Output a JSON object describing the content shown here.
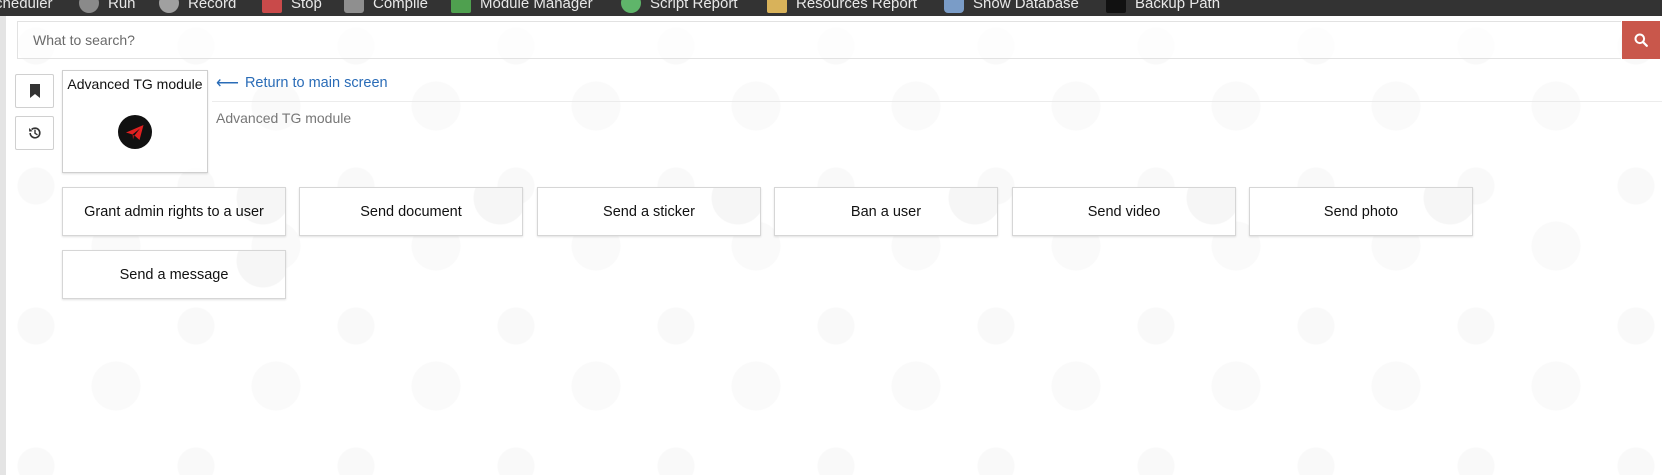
{
  "toolbar": {
    "items": [
      {
        "label": "Scheduler",
        "icon": "calendar-icon"
      },
      {
        "label": "Run",
        "icon": "play-icon"
      },
      {
        "label": "Record",
        "icon": "record-icon"
      },
      {
        "label": "Stop",
        "icon": "stop-icon"
      },
      {
        "label": "Compile",
        "icon": "compile-icon"
      },
      {
        "label": "Module Manager",
        "icon": "home-icon"
      },
      {
        "label": "Script Report",
        "icon": "leaf-icon"
      },
      {
        "label": "Resources Report",
        "icon": "folder-icon"
      },
      {
        "label": "Show Database",
        "icon": "database-icon"
      },
      {
        "label": "Backup Path",
        "icon": "drive-icon"
      }
    ]
  },
  "search": {
    "placeholder": "What to search?",
    "button_icon": "search-icon",
    "button_color": "#c9574b"
  },
  "side_buttons": [
    {
      "icon": "bookmark-icon"
    },
    {
      "icon": "history-icon"
    }
  ],
  "module": {
    "title": "Advanced TG module",
    "icon": "telegram-icon",
    "subtitle": "Advanced TG module",
    "return_link": "Return to main screen",
    "return_icon": "arrow-left-icon"
  },
  "actions": [
    {
      "label": "Grant admin rights to a user"
    },
    {
      "label": "Send document"
    },
    {
      "label": "Send a sticker"
    },
    {
      "label": "Ban a user"
    },
    {
      "label": "Send video"
    },
    {
      "label": "Send photo"
    },
    {
      "label": "Send a message"
    }
  ],
  "colors": {
    "toolbar_bg": "#333333",
    "link": "#2a6cb7",
    "accent": "#c9574b"
  }
}
